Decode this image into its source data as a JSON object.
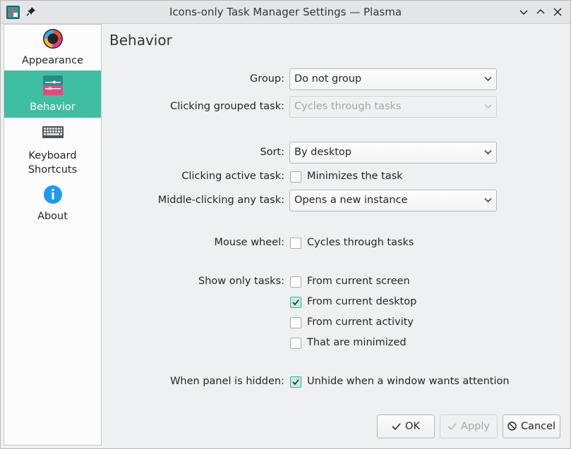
{
  "window": {
    "title": "Icons-only Task Manager Settings — Plasma"
  },
  "sidebar": {
    "items": [
      {
        "label": "Appearance",
        "icon": "color-wheel-icon"
      },
      {
        "label": "Behavior",
        "icon": "sliders-icon",
        "active": true
      },
      {
        "label_line1": "Keyboard",
        "label_line2": "Shortcuts",
        "icon": "keyboard-icon"
      },
      {
        "label": "About",
        "icon": "info-icon"
      }
    ]
  },
  "page": {
    "title": "Behavior",
    "group": {
      "label": "Group:",
      "value": "Do not group"
    },
    "clicking_grouped": {
      "label": "Clicking grouped task:",
      "value": "Cycles through tasks",
      "disabled": true
    },
    "sort": {
      "label": "Sort:",
      "value": "By desktop"
    },
    "clicking_active": {
      "label": "Clicking active task:",
      "option": "Minimizes the task",
      "checked": false
    },
    "middle_click": {
      "label": "Middle-clicking any task:",
      "value": "Opens a new instance"
    },
    "mouse_wheel": {
      "label": "Mouse wheel:",
      "option": "Cycles through tasks",
      "checked": false
    },
    "show_only": {
      "label": "Show only tasks:",
      "options": [
        {
          "text": "From current screen",
          "checked": false
        },
        {
          "text": "From current desktop",
          "checked": true
        },
        {
          "text": "From current activity",
          "checked": false
        },
        {
          "text": "That are minimized",
          "checked": false
        }
      ]
    },
    "panel_hidden": {
      "label": "When panel is hidden:",
      "option": "Unhide when a window wants attention",
      "checked": true
    }
  },
  "buttons": {
    "ok": "OK",
    "apply": "Apply",
    "cancel": "Cancel"
  },
  "colors": {
    "accent": "#3ebfa2",
    "check_fill": "#c7ecdf"
  }
}
